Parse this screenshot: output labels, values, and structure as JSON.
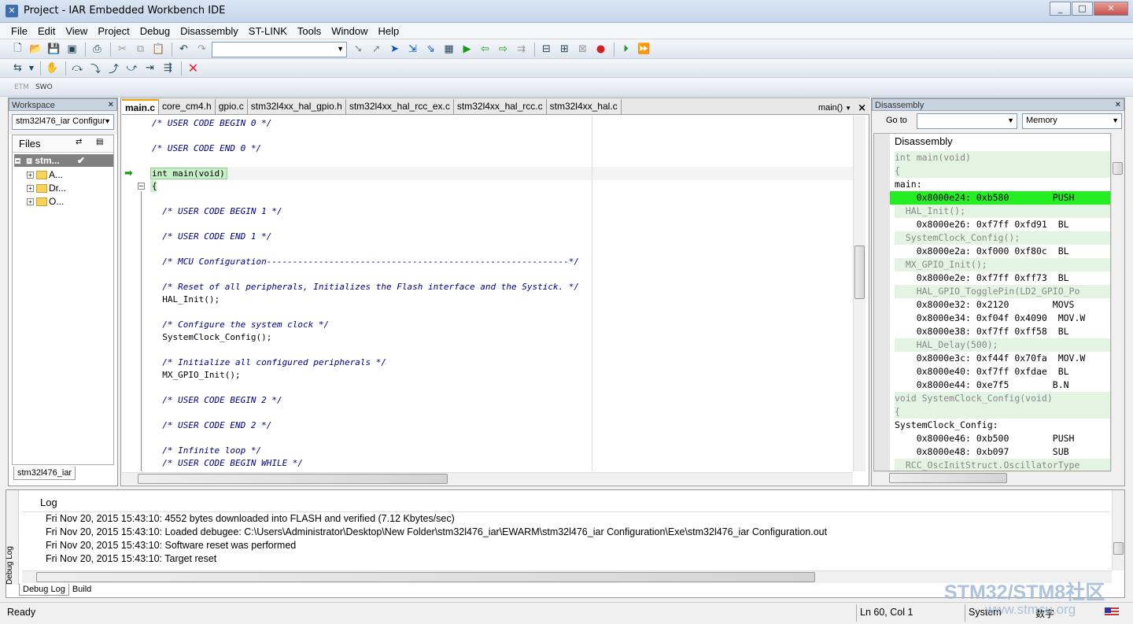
{
  "window": {
    "title": "Project - IAR Embedded Workbench IDE",
    "min": "_",
    "max": "□",
    "close": "✕"
  },
  "menu": [
    "File",
    "Edit",
    "View",
    "Project",
    "Debug",
    "Disassembly",
    "ST-LINK",
    "Tools",
    "Window",
    "Help"
  ],
  "toolbar3": {
    "etm": "ETM",
    "swo": "SWO"
  },
  "workspace": {
    "title": "Workspace",
    "config": "stm32l476_iar Configur",
    "files_header": "Files",
    "root": "stm...",
    "check": "✔",
    "items": [
      "A...",
      "Dr...",
      "O..."
    ],
    "bottom_tab": "stm32l476_iar"
  },
  "editor": {
    "tabs": [
      "main.c",
      "core_cm4.h",
      "gpio.c",
      "stm32l4xx_hal_gpio.h",
      "stm32l4xx_hal_rcc_ex.c",
      "stm32l4xx_hal_rcc.c",
      "stm32l4xx_hal.c"
    ],
    "function": "main()",
    "lines": [
      {
        "text": "/* USER CODE BEGIN 0 */",
        "comment": true
      },
      {
        "text": "",
        "comment": false
      },
      {
        "text": "/* USER CODE END 0 */",
        "comment": true
      },
      {
        "text": "",
        "comment": false
      },
      {
        "text": "int main(void)",
        "comment": false
      },
      {
        "text": "{",
        "comment": false
      },
      {
        "text": "",
        "comment": false
      },
      {
        "text": "  /* USER CODE BEGIN 1 */",
        "comment": true
      },
      {
        "text": "",
        "comment": false
      },
      {
        "text": "  /* USER CODE END 1 */",
        "comment": true
      },
      {
        "text": "",
        "comment": false
      },
      {
        "text": "  /* MCU Configuration----------------------------------------------------------*/",
        "comment": true
      },
      {
        "text": "",
        "comment": false
      },
      {
        "text": "  /* Reset of all peripherals, Initializes the Flash interface and the Systick. */",
        "comment": true
      },
      {
        "text": "  HAL_Init();",
        "comment": false
      },
      {
        "text": "",
        "comment": false
      },
      {
        "text": "  /* Configure the system clock */",
        "comment": true
      },
      {
        "text": "  SystemClock_Config();",
        "comment": false
      },
      {
        "text": "",
        "comment": false
      },
      {
        "text": "  /* Initialize all configured peripherals */",
        "comment": true
      },
      {
        "text": "  MX_GPIO_Init();",
        "comment": false
      },
      {
        "text": "",
        "comment": false
      },
      {
        "text": "  /* USER CODE BEGIN 2 */",
        "comment": true
      },
      {
        "text": "",
        "comment": false
      },
      {
        "text": "  /* USER CODE END 2 */",
        "comment": true
      },
      {
        "text": "",
        "comment": false
      },
      {
        "text": "  /* Infinite loop */",
        "comment": true
      },
      {
        "text": "  /* USER CODE BEGIN WHILE */",
        "comment": true
      }
    ]
  },
  "disassembly": {
    "title": "Disassembly",
    "goto_label": "Go to",
    "memory": "Memory",
    "header": "Disassembly",
    "lines": [
      {
        "text": "int main(void)",
        "kind": "src"
      },
      {
        "text": "{",
        "kind": "src"
      },
      {
        "text": "main:",
        "kind": "lbl"
      },
      {
        "text": "    0x8000e24: 0xb580        PUSH",
        "kind": "hl"
      },
      {
        "text": "  HAL_Init();",
        "kind": "src"
      },
      {
        "text": "    0x8000e26: 0xf7ff 0xfd91  BL",
        "kind": "ins"
      },
      {
        "text": "  SystemClock_Config();",
        "kind": "src"
      },
      {
        "text": "    0x8000e2a: 0xf000 0xf80c  BL",
        "kind": "ins"
      },
      {
        "text": "  MX_GPIO_Init();",
        "kind": "src"
      },
      {
        "text": "    0x8000e2e: 0xf7ff 0xff73  BL",
        "kind": "ins"
      },
      {
        "text": "    HAL_GPIO_TogglePin(LD2_GPIO_Po",
        "kind": "src"
      },
      {
        "text": "    0x8000e32: 0x2120        MOVS",
        "kind": "ins"
      },
      {
        "text": "    0x8000e34: 0xf04f 0x4090  MOV.W",
        "kind": "ins"
      },
      {
        "text": "    0x8000e38: 0xf7ff 0xff58  BL",
        "kind": "ins"
      },
      {
        "text": "    HAL_Delay(500);",
        "kind": "src"
      },
      {
        "text": "    0x8000e3c: 0xf44f 0x70fa  MOV.W",
        "kind": "ins"
      },
      {
        "text": "    0x8000e40: 0xf7ff 0xfdae  BL",
        "kind": "ins"
      },
      {
        "text": "    0x8000e44: 0xe7f5        B.N",
        "kind": "ins"
      },
      {
        "text": "void SystemClock_Config(void)",
        "kind": "src"
      },
      {
        "text": "{",
        "kind": "src"
      },
      {
        "text": "SystemClock_Config:",
        "kind": "lbl"
      },
      {
        "text": "    0x8000e46: 0xb500        PUSH",
        "kind": "ins"
      },
      {
        "text": "    0x8000e48: 0xb097        SUB",
        "kind": "ins"
      },
      {
        "text": "  RCC_OscInitStruct.OscillatorType",
        "kind": "src"
      }
    ]
  },
  "log": {
    "header": "Log",
    "side_label": "Debug Log",
    "lines": [
      "Fri Nov 20, 2015 15:43:10: 4552 bytes downloaded into FLASH and verified (7.12 Kbytes/sec)",
      "Fri Nov 20, 2015 15:43:10: Loaded debugee: C:\\Users\\Administrator\\Desktop\\New Folder\\stm32l476_iar\\EWARM\\stm32l476_iar Configuration\\Exe\\stm32l476_iar Configuration.out",
      "Fri Nov 20, 2015 15:43:10: Software reset was performed",
      "Fri Nov 20, 2015 15:43:10: Target reset"
    ],
    "tabs": [
      "Debug Log",
      "Build"
    ]
  },
  "status": {
    "ready": "Ready",
    "position": "Ln 60, Col 1",
    "system": "System",
    "digits": "数字"
  },
  "watermark": {
    "line1": "STM32/STM8社区",
    "line2": "www.stmcu.org"
  }
}
